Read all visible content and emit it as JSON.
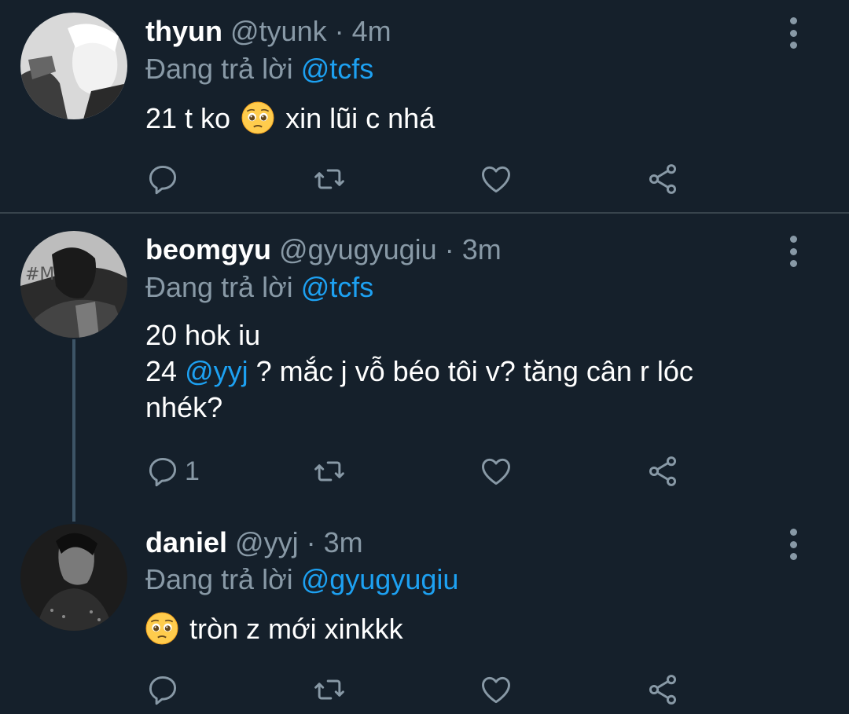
{
  "tweets": [
    {
      "display_name": "thyun",
      "handle": "@tyunk",
      "separator": "·",
      "time": "4m",
      "replying_prefix": "Đang trả lời",
      "replying_to": "@tcfs",
      "text_before_emoji": "21 t ko",
      "text_after_emoji": "xin lũi c nhá",
      "reply_count": ""
    },
    {
      "display_name": "beomgyu",
      "handle": "@gyugyugiu",
      "separator": "·",
      "time": "3m",
      "replying_prefix": "Đang trả lời",
      "replying_to": "@tcfs",
      "line1": "20 hok iu",
      "line2_prefix": "24",
      "line2_mention": "@yyj",
      "line2_rest": "? mắc j vỗ béo tôi v? tăng cân r lóc",
      "line3": "nhék?",
      "reply_count": "1"
    },
    {
      "display_name": "daniel",
      "handle": "@yyj",
      "separator": "·",
      "time": "3m",
      "replying_prefix": "Đang trả lời",
      "replying_to": "@gyugyugiu",
      "text_after_emoji": "tròn z mới xinkkk",
      "reply_count": ""
    }
  ],
  "icons": {
    "reply": "reply-icon",
    "retweet": "retweet-icon",
    "like": "heart-icon",
    "share": "share-icon",
    "more": "more-vertical-icon",
    "emoji": "pleading-face-emoji"
  },
  "colors": {
    "background": "#15202b",
    "muted": "#8899a6",
    "accent": "#1da1f2",
    "divider": "#38444d"
  }
}
